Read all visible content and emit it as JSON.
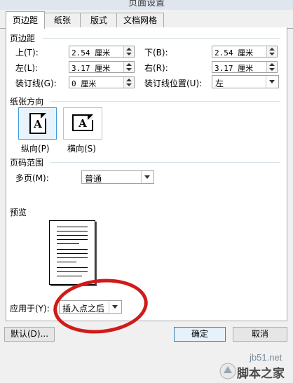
{
  "dialog": {
    "title": "页面设置"
  },
  "tabs": [
    {
      "label": "页边距",
      "active": true
    },
    {
      "label": "纸张",
      "active": false
    },
    {
      "label": "版式",
      "active": false
    },
    {
      "label": "文档网格",
      "active": false
    }
  ],
  "margins": {
    "section_label": "页边距",
    "top": {
      "label": "上(T):",
      "value": "2.54 厘米"
    },
    "bottom": {
      "label": "下(B):",
      "value": "2.54 厘米"
    },
    "left": {
      "label": "左(L):",
      "value": "3.17 厘米"
    },
    "right": {
      "label": "右(R):",
      "value": "3.17 厘米"
    },
    "gutter": {
      "label": "装订线(G):",
      "value": "0 厘米"
    },
    "gutter_pos": {
      "label": "装订线位置(U):",
      "value": "左"
    }
  },
  "orientation": {
    "section_label": "纸张方向",
    "portrait": {
      "label": "纵向(P)",
      "icon": "A",
      "selected": true
    },
    "landscape": {
      "label": "横向(S)",
      "icon": "A",
      "selected": false
    }
  },
  "pages": {
    "section_label": "页码范围",
    "multi_label": "多页(M):",
    "multi_value": "普通"
  },
  "preview": {
    "section_label": "预览",
    "apply_label": "应用于(Y):",
    "apply_value": "插入点之后"
  },
  "buttons": {
    "default_label": "默认(D)...",
    "ok_label": "确定",
    "cancel_label": "取消"
  },
  "watermark": {
    "site": "jb51.net",
    "name": "脚本之家"
  },
  "colors": {
    "annotation": "#d11a1a",
    "selected_border": "#3c9be0"
  }
}
